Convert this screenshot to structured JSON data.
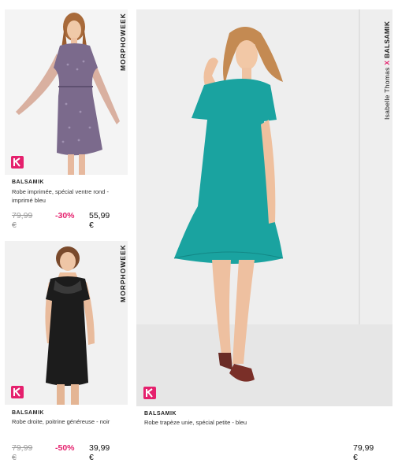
{
  "products": [
    {
      "label": "MORPHOWEEK",
      "brand": "BALSAMIK",
      "name_line1": "Robe imprimée, spécial ventre rond -",
      "name_line2": "imprimé bleu",
      "old_price": "79,99 €",
      "discount": "-30%",
      "price": "55,99 €"
    },
    {
      "label": "MORPHOWEEK",
      "brand": "BALSAMIK",
      "name_line1": "Robe droite, poitrine généreuse - noir",
      "old_price": "79,99 €",
      "discount": "-50%",
      "price": "39,99 €"
    },
    {
      "label_part1": "Isabelle Thomas",
      "label_x": "X",
      "label_part2": "BALSAMIK",
      "brand": "BALSAMIK",
      "name_line1": "Robe trapèze unie, spécial petite - bleu",
      "price": "79,99 €"
    }
  ],
  "colors": {
    "accent": "#e5206d",
    "dress_print": "#7a6a8a",
    "dress_black": "#1a1a1a",
    "dress_teal": "#1aa3a0"
  },
  "icons": [
    "k-logo-icon"
  ]
}
